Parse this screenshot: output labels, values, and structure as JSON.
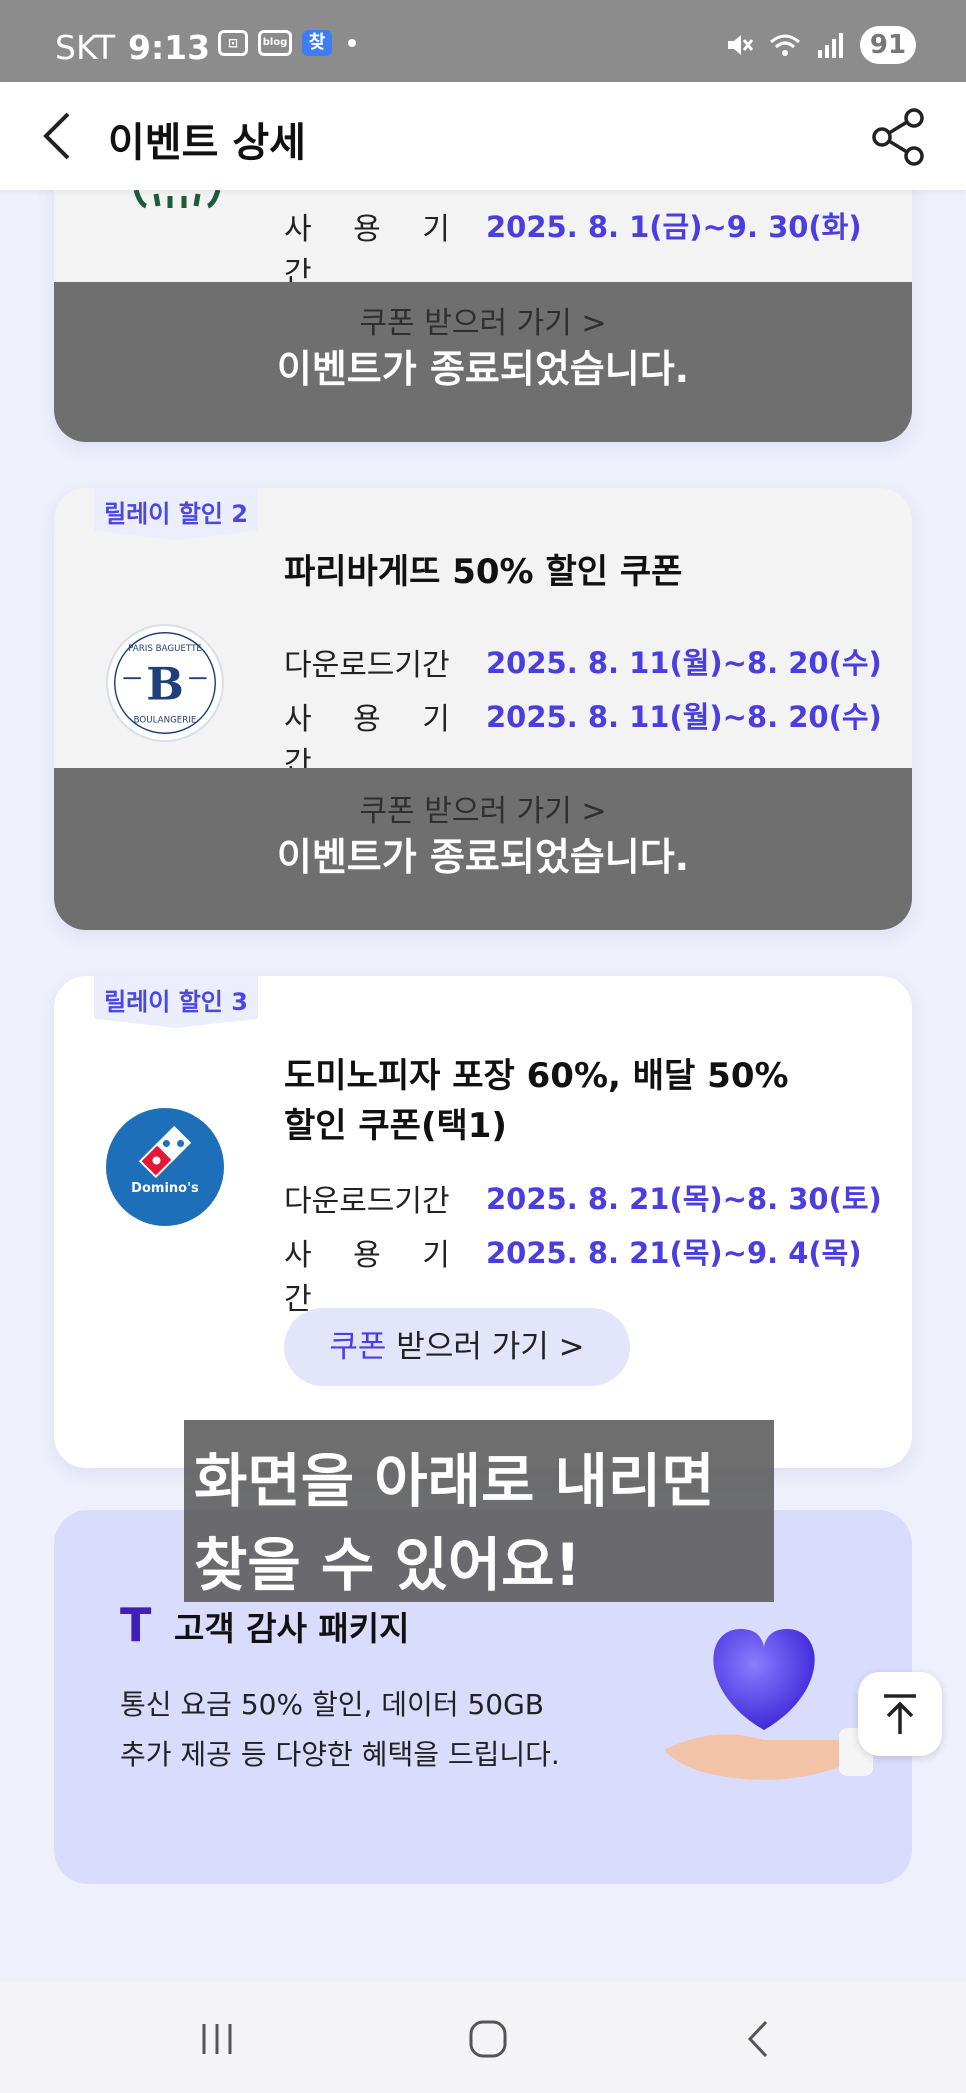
{
  "status_bar": {
    "carrier": "SKT",
    "time": "9:13",
    "icons": [
      "screenshot-icon",
      "blog-icon",
      "app-icon"
    ],
    "blog_label": "blog",
    "app_label": "찾",
    "battery": "91"
  },
  "header": {
    "title": "이벤트 상세"
  },
  "cards": [
    {
      "tag": "",
      "title": "",
      "download_label": "",
      "download_value": "",
      "use_label": "사 용 기 간",
      "use_value": "2025. 8. 1(금)~9. 30(화)",
      "button_prefix": "쿠폰",
      "button_rest": " 받으러 가기 >",
      "ended_text": "이벤트가 종료되었습니다."
    },
    {
      "tag": "릴레이 할인 2",
      "title": "파리바게뜨 50% 할인 쿠폰",
      "download_label": "다운로드기간",
      "download_value": "2025. 8. 11(월)~8. 20(수)",
      "use_label": "사 용 기 간",
      "use_value": "2025. 8. 11(월)~8. 20(수)",
      "button_prefix": "쿠폰",
      "button_rest": " 받으러 가기 >",
      "ended_text": "이벤트가 종료되었습니다.",
      "logo_text_top": "PARIS BAGUETTE",
      "logo_text_bottom": "BOULANGERIE",
      "logo_letter": "B"
    },
    {
      "tag": "릴레이 할인 3",
      "title_line1": "도미노피자 포장 60%, 배달 50%",
      "title_line2": "할인 쿠폰(택1)",
      "download_label": "다운로드기간",
      "download_value": "2025. 8. 21(목)~8. 30(토)",
      "use_label": "사 용 기 간",
      "use_value": "2025. 8. 21(목)~9. 4(목)",
      "button_prefix": "쿠폰",
      "button_rest": " 받으러 가기 >",
      "logo_text": "Domino's"
    }
  ],
  "promo": {
    "logo": "T",
    "title": "고객 감사 패키지",
    "desc_line1": "통신 요금 50% 할인, 데이터 50GB",
    "desc_line2": "추가 제공 등 다양한 혜택을 드립니다."
  },
  "caption": {
    "line1": "화면을 아래로 내리면",
    "line2": "찾을 수 있어요!"
  },
  "colors": {
    "accent": "#4a3ee0",
    "tag_bg": "#ecedfd",
    "ended_overlay": "#6f6f6f",
    "promo_bg": "#d9dcfc",
    "page_bg": "#eef0fb"
  }
}
